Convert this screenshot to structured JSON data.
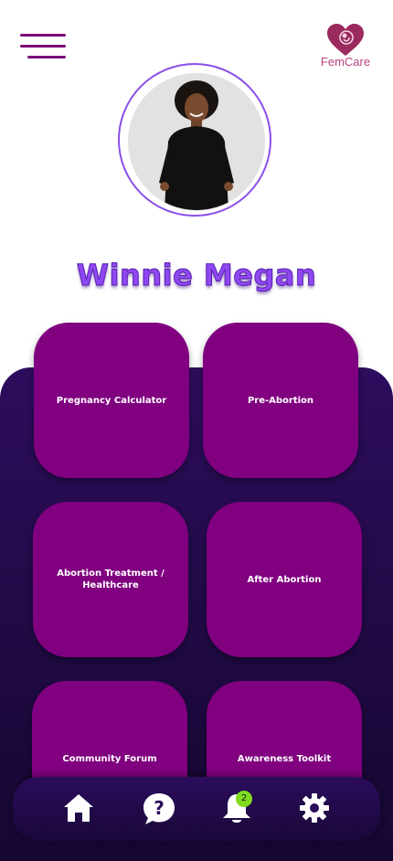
{
  "header": {
    "menu_icon": "hamburger-menu-icon",
    "logo_icon": "heart-fetus-icon",
    "logo_text": "FemCare"
  },
  "profile": {
    "avatar": "profile-photo",
    "name": "Winnie Megan"
  },
  "tiles": [
    {
      "label": "Pregnancy Calculator"
    },
    {
      "label": "Pre-Abortion"
    },
    {
      "label": "Abortion Treatment / Healthcare"
    },
    {
      "label": "After Abortion"
    },
    {
      "label": "Community Forum"
    },
    {
      "label": "Awareness Toolkit"
    }
  ],
  "bottom_nav": {
    "items": [
      {
        "icon": "home-icon"
      },
      {
        "icon": "help-icon"
      },
      {
        "icon": "bell-icon"
      },
      {
        "icon": "settings-icon"
      }
    ],
    "notification_count": "2"
  },
  "colors": {
    "brand_purple": "#800080",
    "accent_violet": "#8e48f0",
    "panel_dark": "#200a44",
    "logo_pink": "#b8437f",
    "badge_green": "#7edb1f"
  }
}
